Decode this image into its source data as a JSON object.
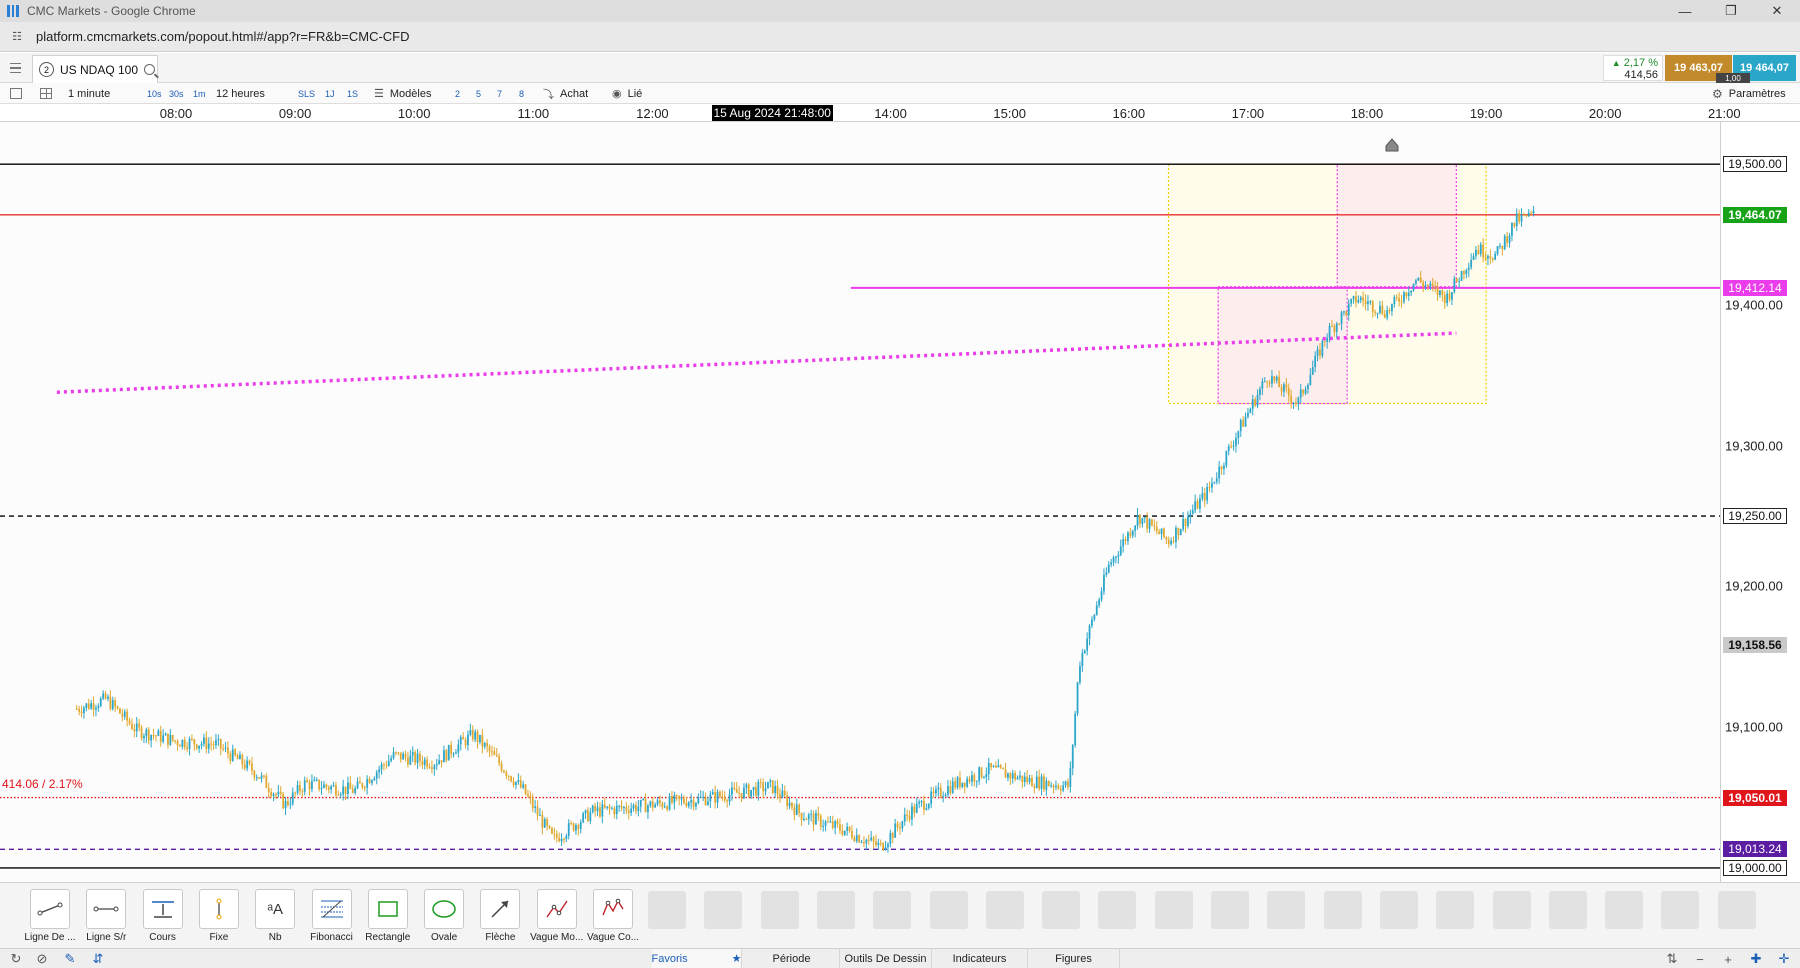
{
  "window": {
    "title": "CMC Markets - Google Chrome",
    "url": "platform.cmcmarkets.com/popout.html#/app?r=FR&b=CMC-CFD",
    "controls": [
      "minimize-icon",
      "restore-icon",
      "close-icon"
    ]
  },
  "instrument": {
    "tab_number": "2",
    "name": "US NDAQ 100",
    "change_pct": "2,17 %",
    "change_abs": "414,56",
    "sell_price": "19 463,07",
    "buy_price": "19 464,07",
    "spread": "1,00",
    "colors": {
      "sell": "#c28a2b",
      "buy": "#2aa6c9",
      "up": "#1e8d2b"
    }
  },
  "toolbar": {
    "interval": "1 minute",
    "quick_intervals": [
      "10s",
      "30s",
      "1m"
    ],
    "period": "12 heures",
    "period_quick": [
      "SLS",
      "1J",
      "1S"
    ],
    "templates_label": "Modèles",
    "template_slots": [
      "2",
      "5",
      "7",
      "8"
    ],
    "order_label": "Achat",
    "linked_label": "Lié",
    "settings_label": "Paramètres"
  },
  "chart_data": {
    "type": "candlestick",
    "instrument": "US NDAQ 100",
    "interval": "1 minute",
    "x_ticks": [
      "08:00",
      "09:00",
      "10:00",
      "11:00",
      "12:00",
      "13:00",
      "14:00",
      "15:00",
      "16:00",
      "17:00",
      "18:00",
      "19:00",
      "20:00",
      "21:00"
    ],
    "crosshair_time": "15 Aug 2024 21:48:00",
    "y_ticks": [
      "19,000.00",
      "19,100.00",
      "19,200.00",
      "19,300.00",
      "19,400.00",
      "19,500.00"
    ],
    "ylim": [
      18990,
      19530
    ],
    "price_path": [
      [
        "07:10",
        19113
      ],
      [
        "07:25",
        19120
      ],
      [
        "07:40",
        19098
      ],
      [
        "08:00",
        19090
      ],
      [
        "08:20",
        19088
      ],
      [
        "08:40",
        19068
      ],
      [
        "08:55",
        19045
      ],
      [
        "09:05",
        19060
      ],
      [
        "09:30",
        19055
      ],
      [
        "09:50",
        19080
      ],
      [
        "10:10",
        19075
      ],
      [
        "10:30",
        19095
      ],
      [
        "10:55",
        19055
      ],
      [
        "11:10",
        19020
      ],
      [
        "11:30",
        19040
      ],
      [
        "12:00",
        19045
      ],
      [
        "12:30",
        19050
      ],
      [
        "13:00",
        19058
      ],
      [
        "13:15",
        19038
      ],
      [
        "13:40",
        19025
      ],
      [
        "13:55",
        19015
      ],
      [
        "14:10",
        19040
      ],
      [
        "14:30",
        19058
      ],
      [
        "14:50",
        19070
      ],
      [
        "15:10",
        19062
      ],
      [
        "15:30",
        19058
      ],
      [
        "15:35",
        19145
      ],
      [
        "15:50",
        19215
      ],
      [
        "16:05",
        19250
      ],
      [
        "16:20",
        19232
      ],
      [
        "16:40",
        19268
      ],
      [
        "16:55",
        19310
      ],
      [
        "17:10",
        19350
      ],
      [
        "17:25",
        19330
      ],
      [
        "17:40",
        19380
      ],
      [
        "17:55",
        19405
      ],
      [
        "18:10",
        19395
      ],
      [
        "18:25",
        19418
      ],
      [
        "18:40",
        19405
      ],
      [
        "18:55",
        19440
      ],
      [
        "19:05",
        19435
      ],
      [
        "19:15",
        19460
      ],
      [
        "19:25",
        19464
      ]
    ],
    "price_labels": [
      {
        "text": "19,500.00",
        "price": 19500,
        "style": "outline"
      },
      {
        "text": "19,464.07",
        "price": 19464.07,
        "style": "green"
      },
      {
        "text": "19,412.14",
        "price": 19412.14,
        "style": "magenta"
      },
      {
        "text": "19,250.00",
        "price": 19250,
        "style": "outline"
      },
      {
        "text": "19,158.56",
        "price": 19158.56,
        "style": "grey"
      },
      {
        "text": "19,050.01",
        "price": 19050.01,
        "style": "red"
      },
      {
        "text": "19,013.24",
        "price": 19013.24,
        "style": "purple"
      },
      {
        "text": "19,000.00",
        "price": 19000,
        "style": "outline"
      }
    ],
    "change_annotation": "414.06 / 2.17%",
    "horizontal_lines": [
      {
        "price": 19500,
        "color": "#000000",
        "style": "solid"
      },
      {
        "price": 19464.07,
        "color": "#e8302e",
        "style": "solid"
      },
      {
        "price": 19412.14,
        "color": "#ea3cea",
        "style": "solid",
        "from_time": "13:40"
      },
      {
        "price": 19250,
        "color": "#000000",
        "style": "dashed"
      },
      {
        "price": 19050.01,
        "color": "#e0141b",
        "style": "dotted"
      },
      {
        "price": 19013.24,
        "color": "#5b1ea3",
        "style": "dashed"
      },
      {
        "price": 19000,
        "color": "#000000",
        "style": "solid"
      }
    ],
    "trend_line": {
      "color": "#ea3cea",
      "style": "dotted",
      "start": [
        "07:00",
        19338
      ],
      "end": [
        "18:45",
        19380
      ]
    },
    "rectangles": [
      {
        "color": "#f0d000",
        "fill": "#fffbe6",
        "t1": "16:20",
        "t2": "19:00",
        "p1": 19500,
        "p2": 19330
      },
      {
        "color": "#ea3cea",
        "fill": "#fde8ec",
        "t1": "16:45",
        "t2": "17:50",
        "p1": 19413,
        "p2": 19330
      },
      {
        "color": "#ea3cea",
        "fill": "#fde8ec",
        "t1": "17:45",
        "t2": "18:45",
        "p1": 19500,
        "p2": 19413
      }
    ],
    "candle_colors": {
      "up": "#2aa6c9",
      "down": "#e0a830"
    },
    "marker_icon": "home-marker-icon",
    "grid": false
  },
  "palette": {
    "tools": [
      {
        "label": "Ligne De ...",
        "icon": "trend-line-icon"
      },
      {
        "label": "Ligne S/r",
        "icon": "support-resistance-icon"
      },
      {
        "label": "Cours",
        "icon": "price-line-icon"
      },
      {
        "label": "Fixe",
        "icon": "vertical-line-icon"
      },
      {
        "label": "Nb",
        "icon": "text-icon"
      },
      {
        "label": "Fibonacci",
        "icon": "fibonacci-icon"
      },
      {
        "label": "Rectangle",
        "icon": "rectangle-icon"
      },
      {
        "label": "Ovale",
        "icon": "ellipse-icon"
      },
      {
        "label": "Flèche",
        "icon": "arrow-icon"
      },
      {
        "label": "Vague Mo...",
        "icon": "wave-motive-icon"
      },
      {
        "label": "Vague Co...",
        "icon": "wave-corrective-icon"
      }
    ],
    "empty_slots": 20
  },
  "bottom_tabs": [
    {
      "label": "Favoris",
      "active": true
    },
    {
      "label": "Période",
      "active": false
    },
    {
      "label": "Outils De Dessin",
      "active": false
    },
    {
      "label": "Indicateurs",
      "active": false
    },
    {
      "label": "Figures",
      "active": false
    }
  ]
}
